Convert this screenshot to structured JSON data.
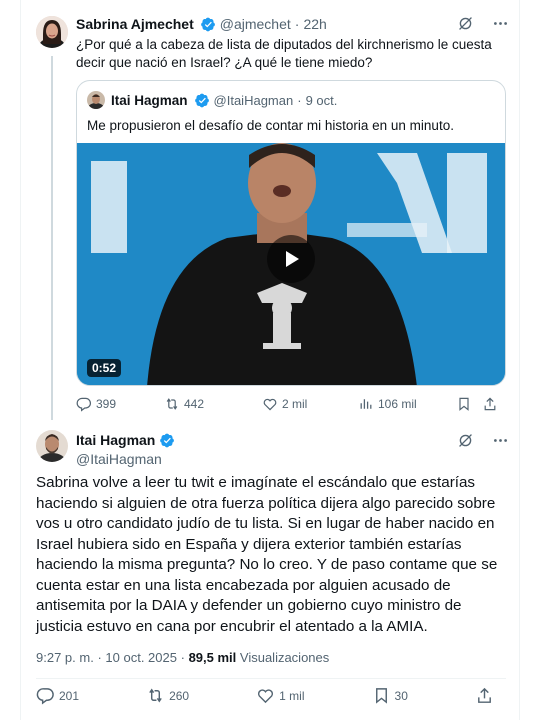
{
  "parent": {
    "name": "Sabrina Ajmechet",
    "handle": "@ajmechet",
    "dot": "·",
    "time": "22h",
    "text": "¿Por qué a la cabeza de lista de diputados del kirchnerismo le cuesta decir que nació en Israel? ¿A qué le tiene miedo?",
    "quote": {
      "name": "Itai Hagman",
      "handle": "@ItaiHagman",
      "dot": "·",
      "date": "9 oct.",
      "text": "Me propusieron el desafío de contar mi historia en un minuto.",
      "video_duration": "0:52"
    },
    "actions": {
      "replies": "399",
      "reposts": "442",
      "likes": "2 mil",
      "views": "106 mil"
    }
  },
  "main": {
    "name": "Itai Hagman",
    "handle": "@ItaiHagman",
    "text": "Sabrina volve a leer tu twit e imagínate el escándalo que estarías haciendo si alguien de otra fuerza política dijera algo parecido sobre vos u otro candidato judío de tu lista. Si en lugar de haber nacido en Israel hubiera sido en España y dijera exterior también estarías haciendo la misma pregunta? No lo creo. Y de paso contame que se cuenta estar en una lista encabezada por alguien acusado de antisemita por la DAIA y defender un gobierno cuyo ministro de justicia estuvo en cana por encubrir el atentado a la AMIA.",
    "time": "9:27 p. m.",
    "dot": "·",
    "date": "10 oct. 2025",
    "dot2": "·",
    "views_count": "89,5 mil",
    "views_label": "Visualizaciones",
    "actions": {
      "replies": "201",
      "reposts": "260",
      "likes": "1 mil",
      "bookmarks": "30"
    }
  },
  "colors": {
    "verified": "#1d9bf0",
    "muted": "#536471",
    "text": "#0f1419",
    "border": "#cfd9de",
    "video_bg": "#1f89c6"
  },
  "icons": [
    "verified-badge-icon",
    "grok-icon",
    "more-icon",
    "reply-icon",
    "repost-icon",
    "like-icon",
    "views-icon",
    "bookmark-icon",
    "share-icon",
    "play-icon"
  ]
}
